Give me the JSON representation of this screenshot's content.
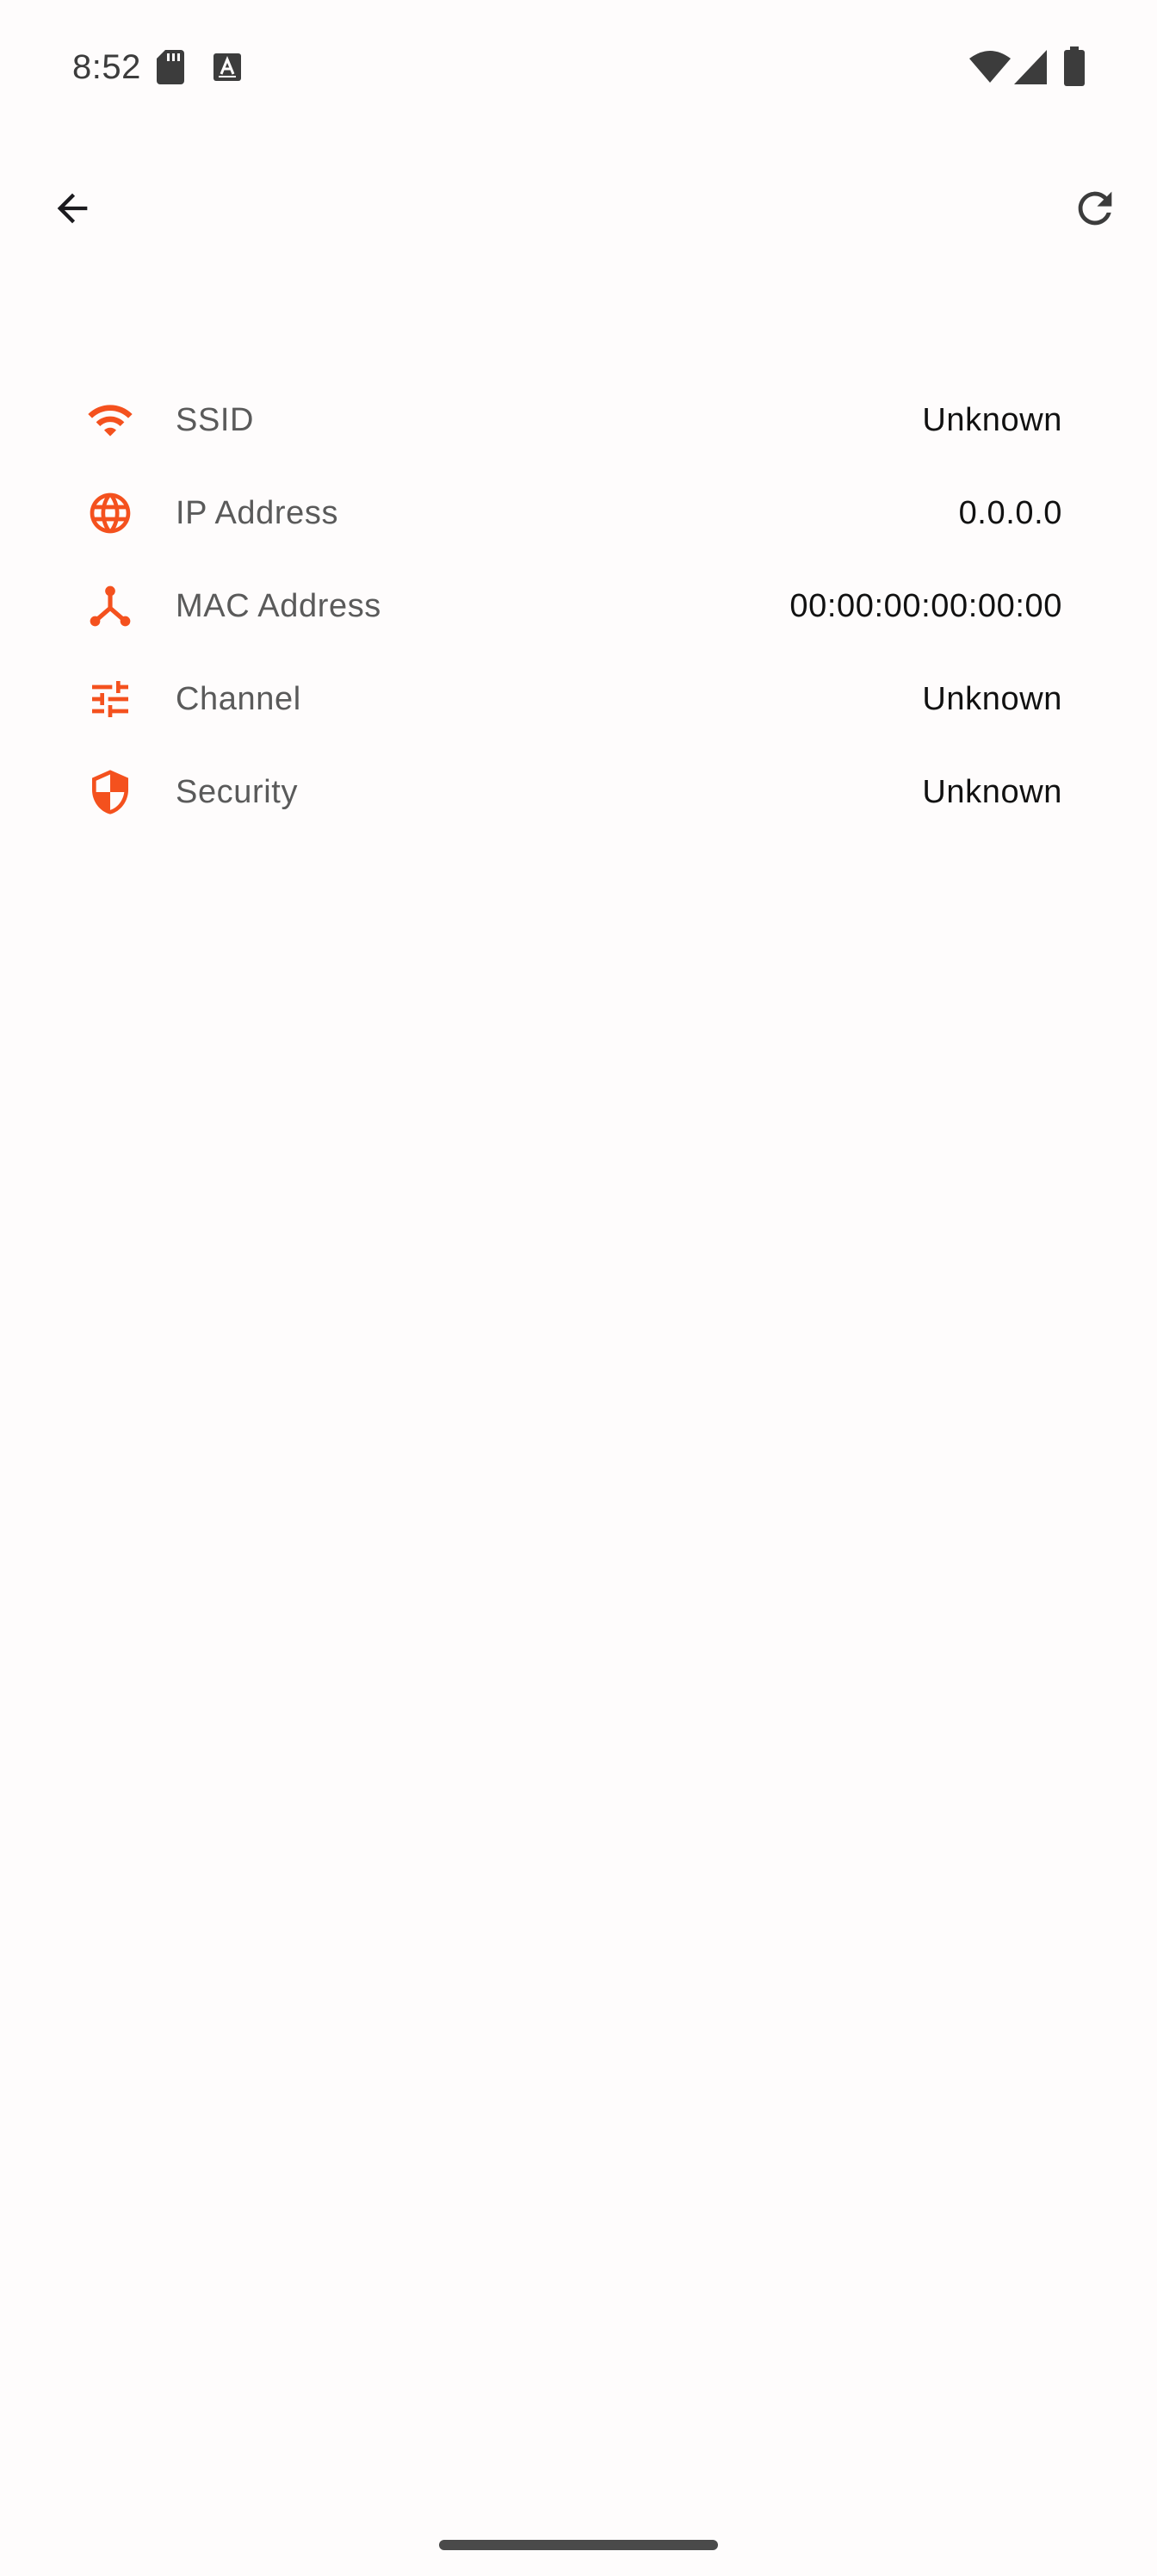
{
  "status_bar": {
    "time": "8:52",
    "icons_left": [
      "sd-card-icon",
      "text-a-icon"
    ],
    "icons_right": [
      "wifi-icon",
      "cell-signal-icon",
      "battery-icon"
    ]
  },
  "app_bar": {
    "back_icon": "arrow-back-icon",
    "refresh_icon": "refresh-icon"
  },
  "accent_color": "#f4511e",
  "info_rows": [
    {
      "key": "ssid",
      "icon": "wifi-icon",
      "label": "SSID",
      "value": "Unknown"
    },
    {
      "key": "ip",
      "icon": "globe-icon",
      "label": "IP Address",
      "value": "0.0.0.0"
    },
    {
      "key": "mac",
      "icon": "network-node-icon",
      "label": "MAC Address",
      "value": "00:00:00:00:00:00"
    },
    {
      "key": "channel",
      "icon": "tune-icon",
      "label": "Channel",
      "value": "Unknown"
    },
    {
      "key": "security",
      "icon": "shield-icon",
      "label": "Security",
      "value": "Unknown"
    }
  ]
}
